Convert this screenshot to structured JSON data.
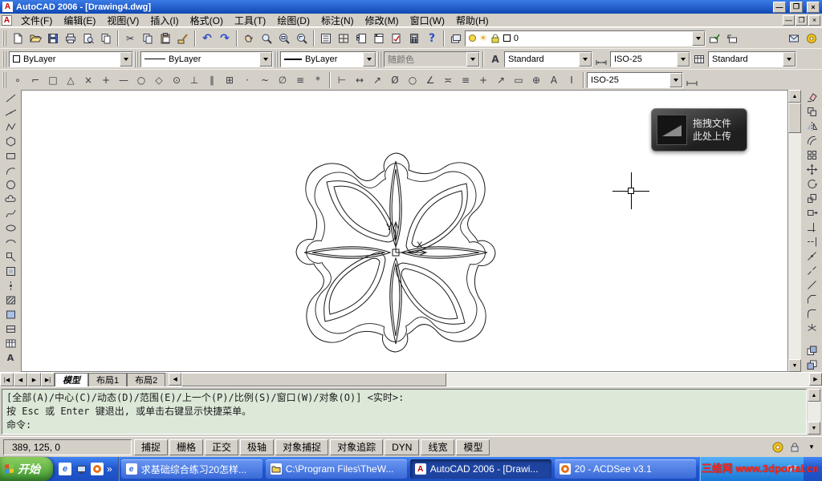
{
  "window": {
    "title": "AutoCAD 2006 - [Drawing4.dwg]"
  },
  "menu": {
    "items": [
      "文件(F)",
      "编辑(E)",
      "视图(V)",
      "插入(I)",
      "格式(O)",
      "工具(T)",
      "绘图(D)",
      "标注(N)",
      "修改(M)",
      "窗口(W)",
      "帮助(H)"
    ]
  },
  "properties": {
    "layer": "0",
    "color": "ByLayer",
    "linetype": "ByLayer",
    "lineweight": "ByLayer",
    "plot_style": "随颜色",
    "text_style": "Standard",
    "dim_style": "ISO-25",
    "table_style": "Standard",
    "dim_style2": "ISO-25"
  },
  "icon_names": {
    "standard": [
      "new",
      "open",
      "save",
      "plot",
      "plot-preview",
      "publish",
      "cut",
      "copy",
      "paste",
      "match-properties",
      "undo",
      "redo",
      "pan",
      "zoom-realtime",
      "zoom-window",
      "zoom-previous",
      "properties",
      "designcenter",
      "tool-palettes",
      "sheet-set-manager",
      "markup",
      "quickcalc",
      "help"
    ],
    "draw": [
      "line",
      "construction-line",
      "polyline",
      "polygon",
      "rectangle",
      "arc",
      "circle",
      "revision-cloud",
      "spline",
      "ellipse",
      "ellipse-arc",
      "insert-block",
      "make-block",
      "point",
      "hatch",
      "gradient",
      "region",
      "table",
      "multiline-text"
    ],
    "modify": [
      "erase",
      "copy",
      "mirror",
      "offset",
      "array",
      "move",
      "rotate",
      "scale",
      "stretch",
      "trim",
      "extend",
      "break-at-point",
      "break",
      "join",
      "chamfer",
      "fillet",
      "explode"
    ]
  },
  "canvas": {
    "ucs_y_label": "Y",
    "ucs_x_label": "X",
    "upload_overlay_line1": "拖拽文件",
    "upload_overlay_line2": "此处上传"
  },
  "tabs": {
    "model": "模型",
    "layout1": "布局1",
    "layout2": "布局2"
  },
  "command": {
    "history1": "[全部(A)/中心(C)/动态(D)/范围(E)/上一个(P)/比例(S)/窗口(W)/对象(O)] <实时>:",
    "history2": "按 Esc 或 Enter 键退出, 或单击右键显示快捷菜单。",
    "prompt": "命令:"
  },
  "status": {
    "coords": "389, 125, 0",
    "buttons": [
      "捕捉",
      "栅格",
      "正交",
      "极轴",
      "对象捕捉",
      "对象追踪",
      "DYN",
      "线宽",
      "模型"
    ]
  },
  "taskbar": {
    "start": "开始",
    "items": [
      {
        "label": "求基础综合练习20怎样..."
      },
      {
        "label": "C:\\Program Files\\TheW..."
      },
      {
        "label": "AutoCAD 2006 - [Drawi..."
      },
      {
        "label": "20 - ACDSee v3.1"
      }
    ],
    "watermark": "三维网 www.3dportal.cn",
    "clock": "08"
  }
}
